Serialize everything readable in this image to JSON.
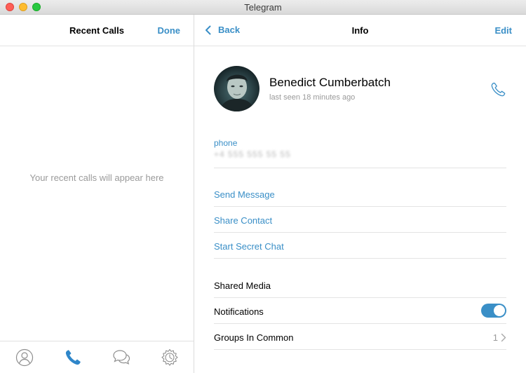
{
  "window": {
    "title": "Telegram"
  },
  "left": {
    "title": "Recent Calls",
    "done_label": "Done",
    "empty_message": "Your recent calls will appear here",
    "tabs": [
      {
        "icon": "contacts-icon",
        "active": false
      },
      {
        "icon": "phone-icon",
        "active": true
      },
      {
        "icon": "chats-icon",
        "active": false
      },
      {
        "icon": "settings-icon",
        "active": false
      }
    ]
  },
  "right": {
    "back_label": "Back",
    "title": "Info",
    "edit_label": "Edit",
    "contact": {
      "name": "Benedict Cumberbatch",
      "last_seen": "last seen 18 minutes ago"
    },
    "phone": {
      "label": "phone",
      "value": "+4 555 555 55 55"
    },
    "actions": {
      "send_message": "Send Message",
      "share_contact": "Share Contact",
      "secret_chat": "Start Secret Chat"
    },
    "shared_media": "Shared Media",
    "notifications": {
      "label": "Notifications",
      "enabled": true
    },
    "groups_in_common": {
      "label": "Groups In Common",
      "count": "1"
    }
  },
  "colors": {
    "accent": "#3a8fc7",
    "muted": "#9a9a9a",
    "divider": "#e4e4e4"
  }
}
